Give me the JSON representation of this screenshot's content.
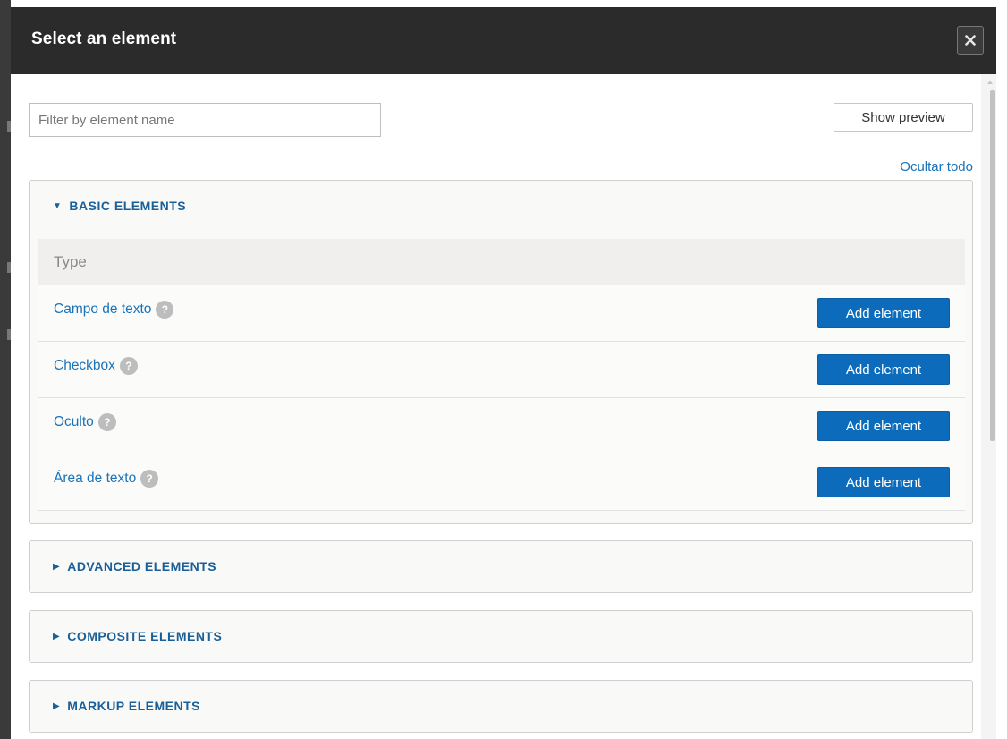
{
  "dialog": {
    "title": "Select an element",
    "close_icon": "close-icon"
  },
  "toolbar": {
    "filter_placeholder": "Filter by element name",
    "filter_value": "",
    "preview_label": "Show preview",
    "hide_all_label": "Ocultar todo"
  },
  "groups": [
    {
      "label": "BASIC ELEMENTS",
      "expanded": true,
      "table_header": "Type",
      "rows": [
        {
          "label": "Campo de texto",
          "button": "Add element"
        },
        {
          "label": "Checkbox",
          "button": "Add element"
        },
        {
          "label": "Oculto",
          "button": "Add element"
        },
        {
          "label": "Área de texto",
          "button": "Add element"
        }
      ]
    },
    {
      "label": "ADVANCED ELEMENTS",
      "expanded": false
    },
    {
      "label": "COMPOSITE ELEMENTS",
      "expanded": false
    },
    {
      "label": "MARKUP ELEMENTS",
      "expanded": false
    }
  ],
  "icons": {
    "expanded": "▼",
    "collapsed": "▶",
    "help": "?"
  },
  "colors": {
    "titlebar": "#2b2b2b",
    "link": "#1a73b8",
    "primary_button": "#0c6cbb"
  }
}
